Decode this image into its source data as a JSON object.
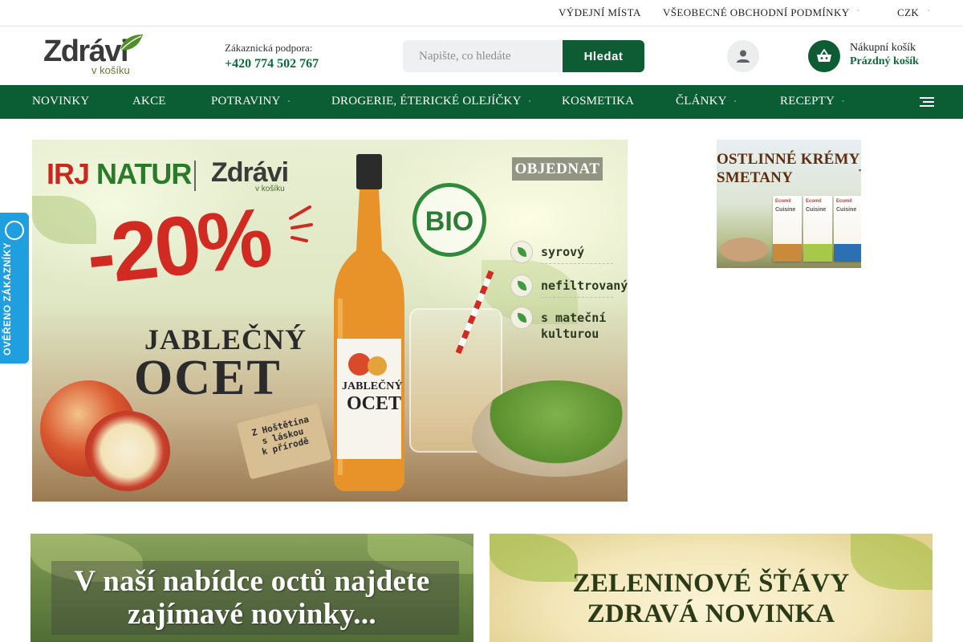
{
  "topbar": {
    "pickup_points": "VÝDEJNÍ MÍSTA",
    "terms": "VŠEOBECNÉ OBCHODNÍ PODMÍNKY",
    "currency": "CZK"
  },
  "header": {
    "logo_text": "Zdrávi",
    "logo_sub": "v košíku",
    "support_label": "Zákaznická podpora:",
    "support_phone": "+420 774 502 767",
    "search": {
      "placeholder": "Napište, co hledáte",
      "button": "Hledat"
    },
    "user_icon": "user-icon",
    "cart": {
      "icon": "basket-icon",
      "label": "Nákupní košík",
      "status": "Prázdný košík"
    }
  },
  "nav": {
    "items": [
      {
        "label": "NOVINKY",
        "has_submenu": false
      },
      {
        "label": "AKCE",
        "has_submenu": false
      },
      {
        "label": "POTRAVINY",
        "has_submenu": true
      },
      {
        "label": "DROGERIE, ÉTERICKÉ OLEJÍČKY",
        "has_submenu": true
      },
      {
        "label": "KOSMETIKA",
        "has_submenu": false
      },
      {
        "label": "ČLÁNKY",
        "has_submenu": true
      },
      {
        "label": "RECEPTY",
        "has_submenu": true
      }
    ],
    "menu_icon": "hamburger-icon"
  },
  "hero": {
    "cta": "OBJEDNAT",
    "brand_left": "IRJ NATUR",
    "brand_right": "Zdrávi",
    "brand_right_sub": "v košíku",
    "discount": "-20%",
    "title_line1": "JABLEČNÝ",
    "title_line2": "OCET",
    "bio_label": "BIO",
    "features": [
      "syrový",
      "nefiltrovaný",
      "s mateční kulturou"
    ],
    "tag_text": [
      "Z Hoštětína",
      "s láskou",
      "k přírodě"
    ],
    "bottle_label": [
      "JABLEČNÝ",
      "OCET"
    ]
  },
  "side_banner": {
    "line1": "OSTLINNÉ KRÉMY",
    "line2": "SMETANY",
    "product_brand": "Ecomil",
    "product_name": "Cuisine"
  },
  "verified_badge": {
    "label": "OVĚŘENO ZÁKAZNÍKY"
  },
  "bottom_banners": {
    "left": {
      "line1": "V naší nabídce octů najdete",
      "line2": "zajímavé novinky..."
    },
    "right": {
      "line1": "ZELENINOVÉ ŠŤÁVY",
      "line2": "ZDRAVÁ NOVINKA"
    }
  },
  "colors": {
    "brand_green": "#0b5e33",
    "accent_red": "#d12a22",
    "badge_blue": "#1f9ee0"
  }
}
